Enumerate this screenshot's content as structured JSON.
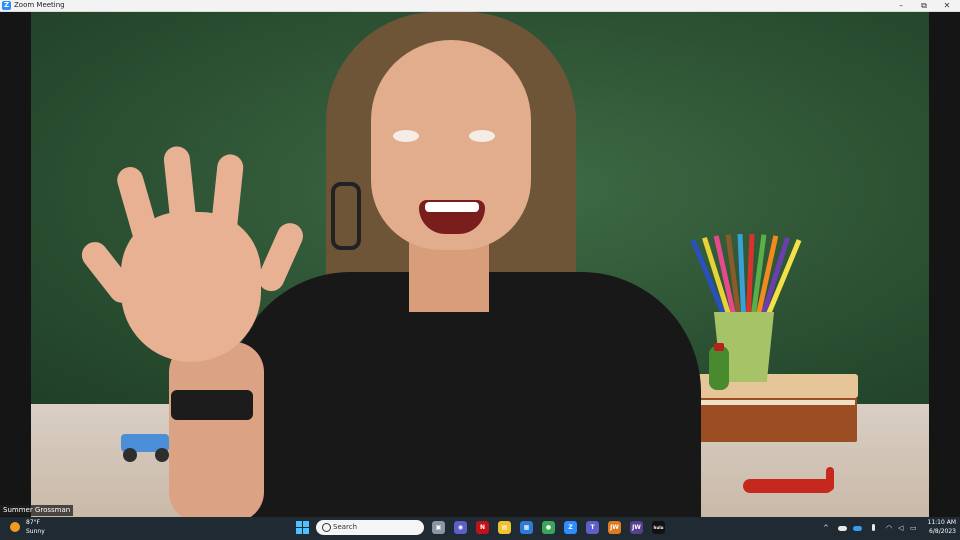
{
  "window": {
    "title": "Zoom Meeting",
    "logo_letter": "Z",
    "controls": {
      "minimize": "–",
      "maximize": "⧉",
      "close": "✕"
    }
  },
  "participant": {
    "name": "Summer Grossman"
  },
  "taskbar": {
    "weather": {
      "temperature": "87°F",
      "condition": "Sunny"
    },
    "search": {
      "placeholder": "Search"
    },
    "apps": [
      {
        "name": "task-view",
        "glyph": "▣",
        "color": "#8a96a3"
      },
      {
        "name": "chat",
        "glyph": "◉",
        "color": "#5b5fc7"
      },
      {
        "name": "netflix",
        "glyph": "N",
        "color": "#c11119"
      },
      {
        "name": "file-explorer",
        "glyph": "▤",
        "color": "#f2c12e"
      },
      {
        "name": "calendar",
        "glyph": "▦",
        "color": "#2f7ad9"
      },
      {
        "name": "chrome",
        "glyph": "●",
        "color": "#3aa757"
      },
      {
        "name": "zoom",
        "glyph": "Z",
        "color": "#2d8cff"
      },
      {
        "name": "teams",
        "glyph": "T",
        "color": "#5b5fc7"
      },
      {
        "name": "jw-orange",
        "glyph": "JW",
        "color": "#e07a1f"
      },
      {
        "name": "jw-purple",
        "glyph": "JW",
        "color": "#5a3f8f"
      },
      {
        "name": "hulu",
        "glyph": "hulu",
        "color": "#111111"
      }
    ],
    "tray": {
      "chevron": "^",
      "wifi": "◠",
      "volume": "◁",
      "battery": "▭"
    },
    "clock": {
      "time": "11:10 AM",
      "date": "6/8/2023"
    }
  }
}
